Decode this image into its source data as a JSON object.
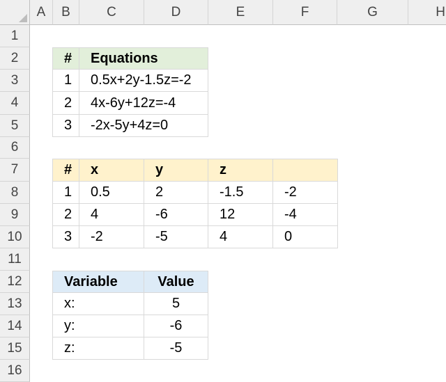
{
  "columns": [
    "A",
    "B",
    "C",
    "D",
    "E",
    "F",
    "G",
    "H"
  ],
  "rows": [
    "1",
    "2",
    "3",
    "4",
    "5",
    "6",
    "7",
    "8",
    "9",
    "10",
    "11",
    "12",
    "13",
    "14",
    "15",
    "16"
  ],
  "table1": {
    "headers": [
      "#",
      "Equations"
    ],
    "rows": [
      [
        "1",
        "0.5x+2y-1.5z=-2"
      ],
      [
        "2",
        "4x-6y+12z=-4"
      ],
      [
        "3",
        "-2x-5y+4z=0"
      ]
    ],
    "header_bg": "#e2efda"
  },
  "table2": {
    "headers": [
      "#",
      "x",
      "y",
      "z",
      ""
    ],
    "rows": [
      [
        "1",
        "0.5",
        "2",
        "-1.5",
        "-2"
      ],
      [
        "2",
        "4",
        "-6",
        "12",
        "-4"
      ],
      [
        "3",
        "-2",
        "-5",
        "4",
        "0"
      ]
    ],
    "header_bg": "#fff2cc"
  },
  "table3": {
    "headers": [
      "Variable",
      "Value"
    ],
    "rows": [
      [
        "x:",
        "5"
      ],
      [
        "y:",
        "-6"
      ],
      [
        "z:",
        "-5"
      ]
    ],
    "header_bg": "#ddebf7"
  }
}
